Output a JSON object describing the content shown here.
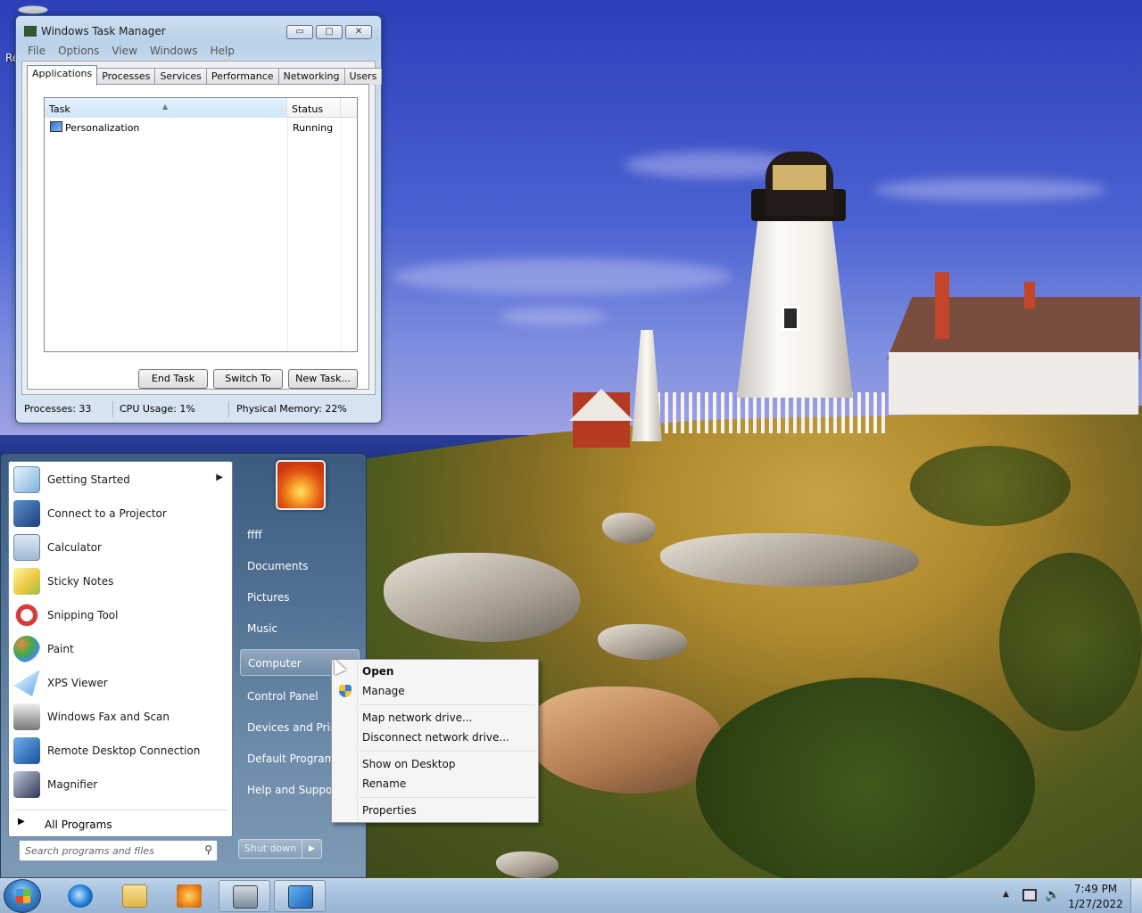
{
  "desktop": {
    "partial_icon_label": "Re"
  },
  "task_manager": {
    "title": "Windows Task Manager",
    "caption_buttons": {
      "minimize": "▭",
      "maximize": "▢",
      "close": "✕"
    },
    "menu": [
      "File",
      "Options",
      "View",
      "Windows",
      "Help"
    ],
    "tabs": [
      "Applications",
      "Processes",
      "Services",
      "Performance",
      "Networking",
      "Users"
    ],
    "active_tab": "Applications",
    "columns": {
      "task": "Task",
      "status": "Status"
    },
    "rows": [
      {
        "task": "Personalization",
        "status": "Running"
      }
    ],
    "buttons": {
      "end_task": "End Task",
      "switch_to": "Switch To",
      "new_task": "New Task..."
    },
    "status": {
      "processes": "Processes: 33",
      "cpu": "CPU Usage: 1%",
      "memory": "Physical Memory: 22%"
    }
  },
  "start_menu": {
    "programs": [
      {
        "label": "Getting Started",
        "icon": "getting-started-icon",
        "submenu": true
      },
      {
        "label": "Connect to a Projector",
        "icon": "projector-icon"
      },
      {
        "label": "Calculator",
        "icon": "calculator-icon"
      },
      {
        "label": "Sticky Notes",
        "icon": "sticky-notes-icon"
      },
      {
        "label": "Snipping Tool",
        "icon": "snipping-tool-icon"
      },
      {
        "label": "Paint",
        "icon": "paint-icon"
      },
      {
        "label": "XPS Viewer",
        "icon": "xps-viewer-icon"
      },
      {
        "label": "Windows Fax and Scan",
        "icon": "fax-scan-icon"
      },
      {
        "label": "Remote Desktop Connection",
        "icon": "remote-desktop-icon"
      },
      {
        "label": "Magnifier",
        "icon": "magnifier-icon"
      }
    ],
    "all_programs": "All Programs",
    "search_placeholder": "Search programs and files",
    "right": {
      "user": "ffff",
      "documents": "Documents",
      "pictures": "Pictures",
      "music": "Music",
      "computer": "Computer",
      "control_panel": "Control Panel",
      "devices": "Devices and Printers",
      "default_programs": "Default Programs",
      "help": "Help and Support"
    },
    "shutdown": "Shut down",
    "shutdown_arrow": "▶"
  },
  "context_menu": {
    "open": "Open",
    "manage": "Manage",
    "map_drive": "Map network drive...",
    "disconnect_drive": "Disconnect network drive...",
    "show_on_desktop": "Show on Desktop",
    "rename": "Rename",
    "properties": "Properties"
  },
  "taskbar": {
    "pinned": [
      "internet-explorer-icon",
      "windows-explorer-icon",
      "media-player-icon",
      "task-manager-icon",
      "personalization-icon"
    ],
    "clock_time": "7:49 PM",
    "clock_date": "1/27/2022",
    "tray_arrow": "▲",
    "volume_glyph": "🔊"
  },
  "colors": {
    "start_menu_bg": "#4d6e91",
    "taskbar_bg": "#a9c3df",
    "selection": "#cfe6f8"
  }
}
